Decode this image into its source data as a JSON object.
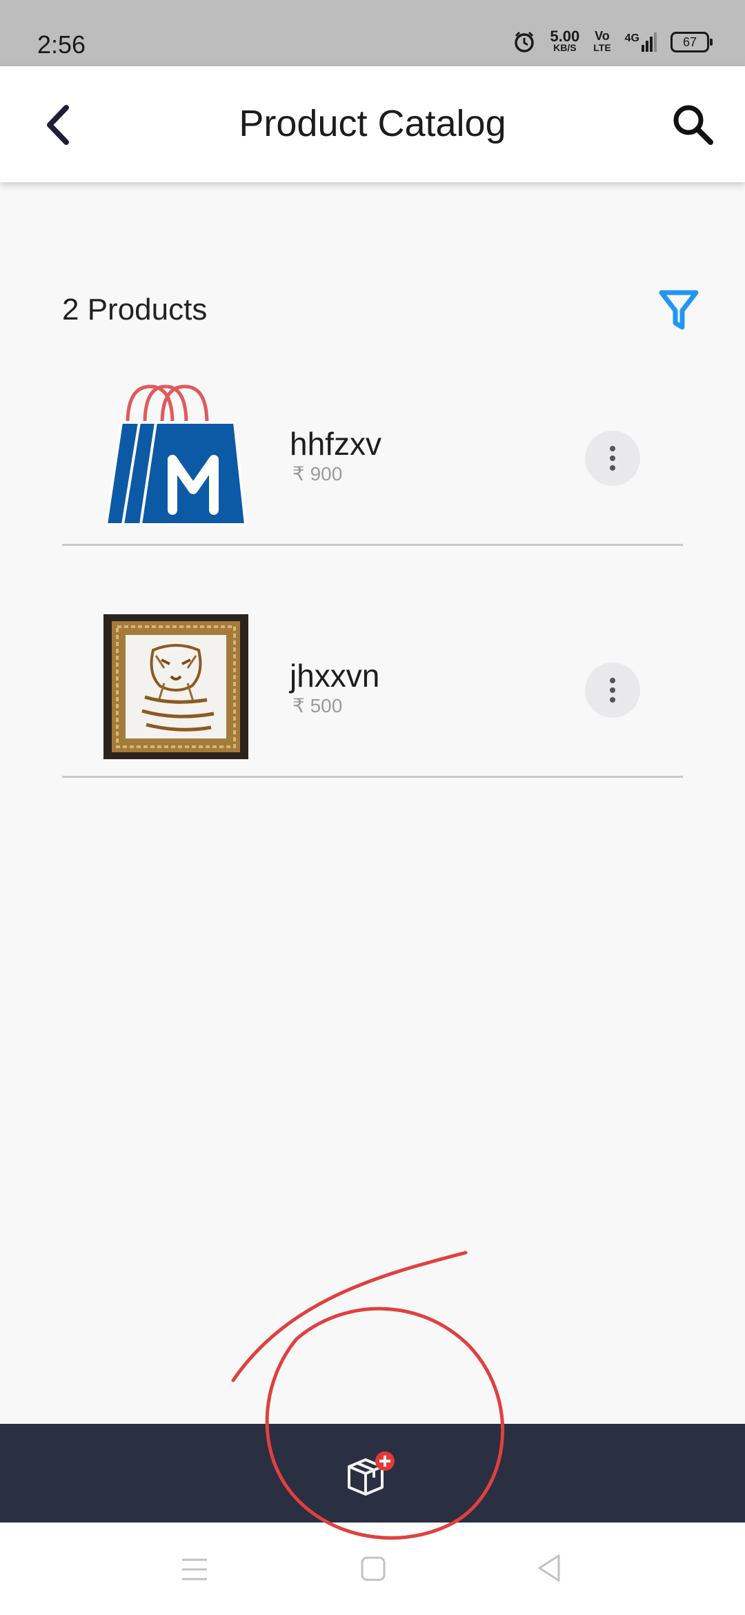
{
  "status": {
    "time": "2:56",
    "speed_value": "5.00",
    "speed_unit": "KB/S",
    "volte_top": "Vo",
    "volte_bottom": "LTE",
    "network": "4G",
    "battery": "67"
  },
  "header": {
    "title": "Product Catalog",
    "back_icon": "back-arrow-icon",
    "search_icon": "search-icon"
  },
  "catalog": {
    "count_label": "2 Products",
    "filter_icon": "filter-icon",
    "filter_color": "#2196f3",
    "products": [
      {
        "name": "hhfzxv",
        "price": "₹ 900",
        "thumbnail": "shopping-bag-logo"
      },
      {
        "name": "jhxxvn",
        "price": "₹ 500",
        "thumbnail": "framed-tiger-picture"
      }
    ]
  },
  "bottom_bar": {
    "add_product_icon": "add-product-box-icon",
    "background": "#2a2f42",
    "badge_color": "#e53935"
  },
  "annotation_color": "#e04040"
}
